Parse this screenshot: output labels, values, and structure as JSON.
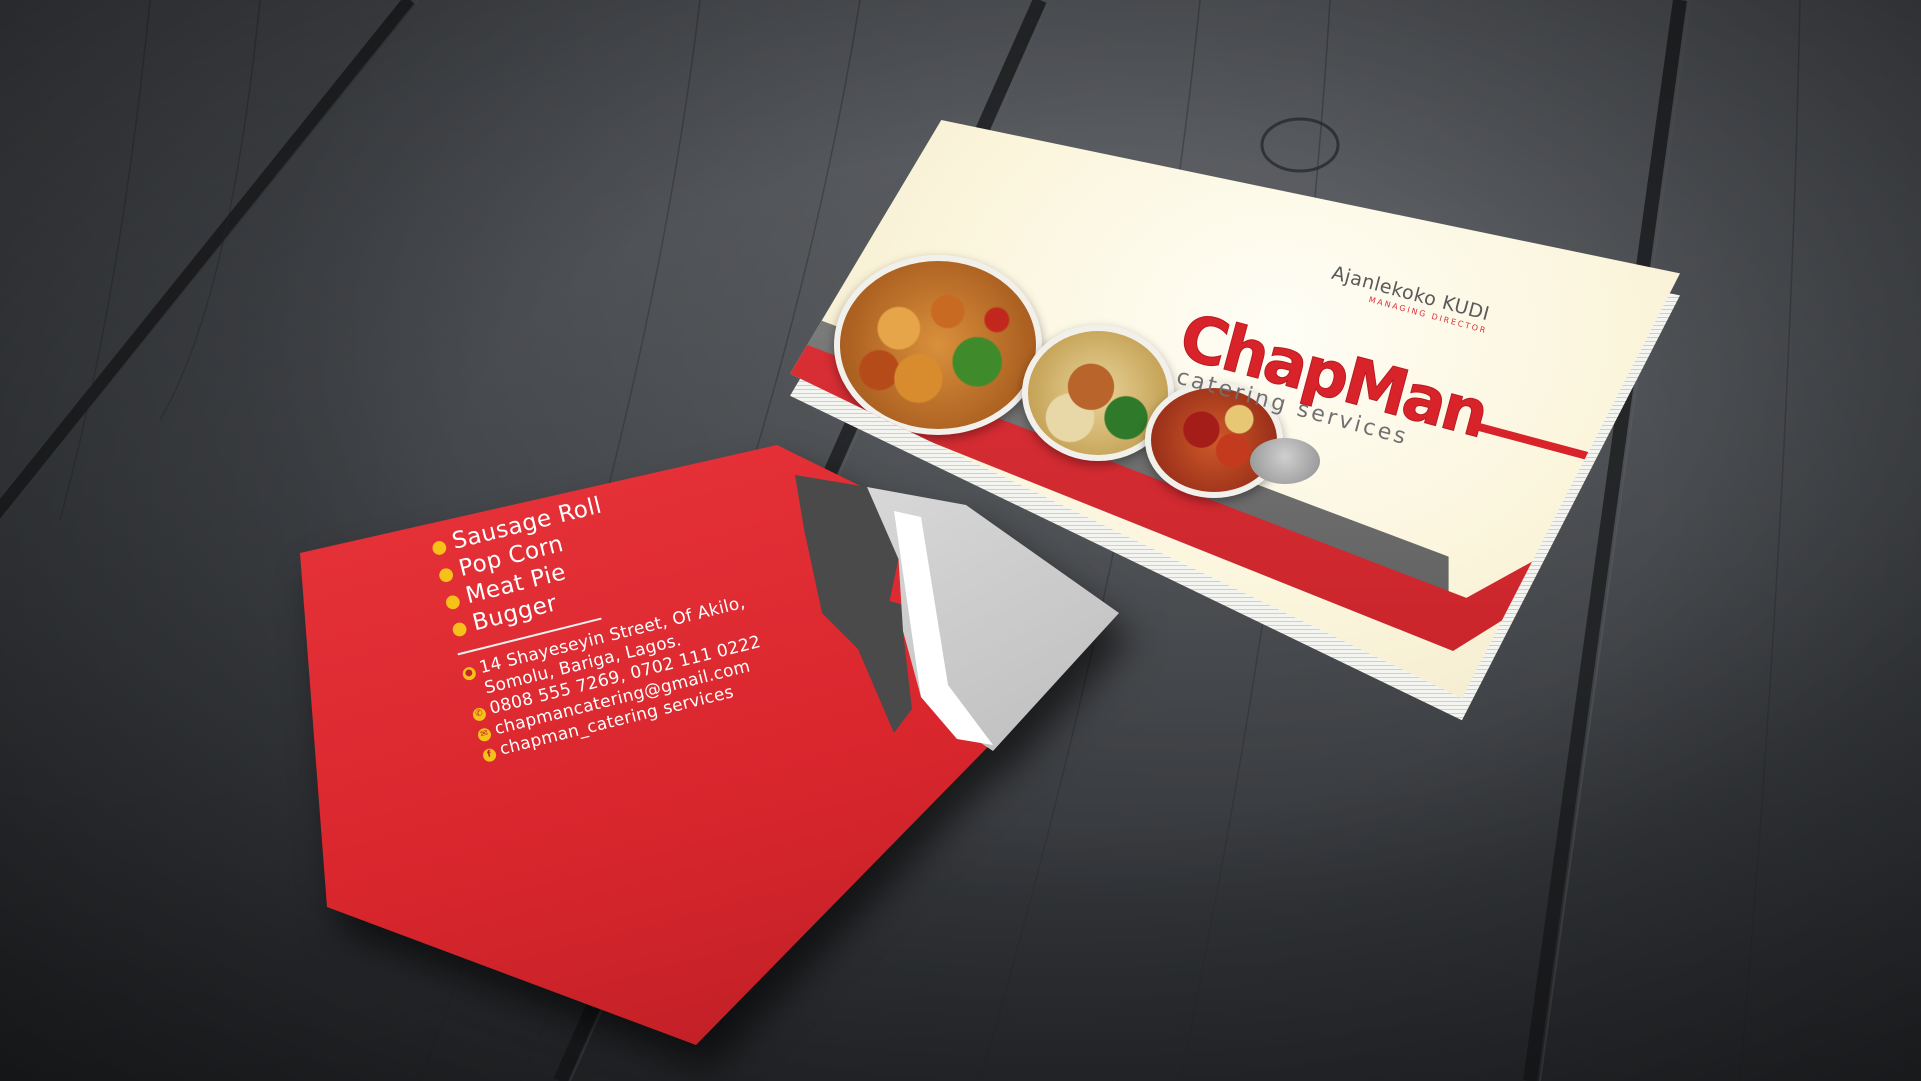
{
  "front": {
    "name": "Ajanlekoko KUDI",
    "role": "MANAGING DIRECTOR",
    "logo_main": "ChapMan",
    "logo_sub": "catering services"
  },
  "back": {
    "menu": [
      "Sausage Roll",
      "Pop Corn",
      "Meat Pie",
      "Bugger"
    ],
    "address_line1": "14 Shayeseyin Street, Of Akilo,",
    "address_line2": "Somolu, Bariga, Lagos.",
    "phone": "0808 555 7269, 0702 111 0222",
    "email": "chapmancatering@gmail.com",
    "social": "chapman_catering services"
  },
  "colors": {
    "brand_red": "#d8232a",
    "bullet_yellow": "#f6c21a",
    "card_cream": "#fbf5dc",
    "table_grey": "#3f4246"
  },
  "icons": [
    "location-icon",
    "phone-icon",
    "email-icon",
    "facebook-icon",
    "fork-icon",
    "knife-icon"
  ]
}
